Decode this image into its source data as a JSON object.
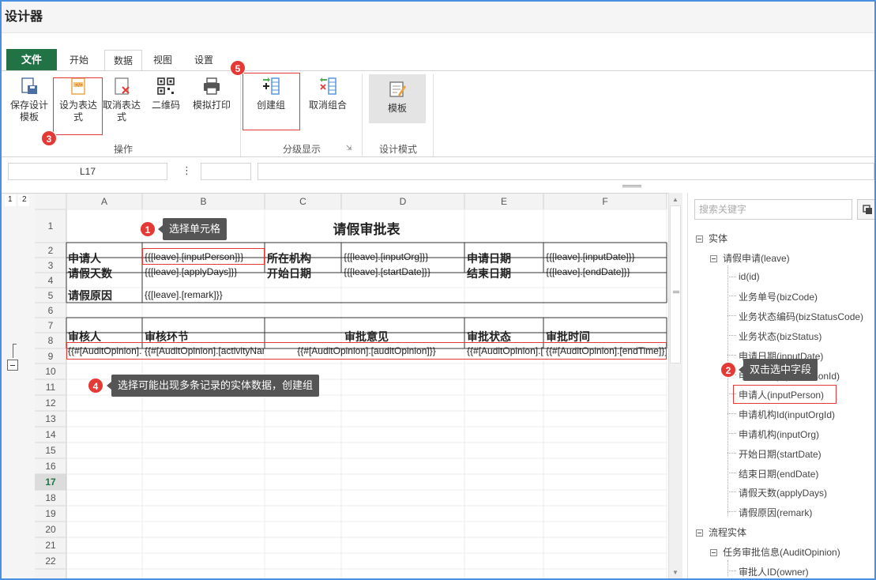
{
  "window": {
    "title": "设计器"
  },
  "tabs": [
    {
      "label": "文件"
    },
    {
      "label": "开始"
    },
    {
      "label": "数据"
    },
    {
      "label": "视图"
    },
    {
      "label": "设置"
    }
  ],
  "ribbon": {
    "save_template": "保存设计模板",
    "set_expression": "设为表达式",
    "cancel_expression": "取消表达式",
    "qrcode": "二维码",
    "simulate_print": "模拟打印",
    "create_group": "创建组",
    "ungroup": "取消组合",
    "template": "模板",
    "group_operate": "操作",
    "group_outline": "分级显示",
    "group_design": "设计模式"
  },
  "formula_bar": {
    "cell_ref": "L17",
    "sep": "⋮"
  },
  "sheet": {
    "outline_levels": [
      "1",
      "2"
    ],
    "col_headers": [
      "A",
      "B",
      "C",
      "D",
      "E",
      "F"
    ],
    "row_headers": [
      "1",
      "2",
      "3",
      "4",
      "5",
      "6",
      "7",
      "8",
      "9",
      "10",
      "11",
      "12",
      "13",
      "14",
      "15",
      "16",
      "17",
      "18",
      "19",
      "20",
      "21",
      "22"
    ],
    "title": "请假审批表",
    "r2": [
      "申请人",
      "{{[leave].[inputPerson]}}",
      "所在机构",
      "{{[leave].[inputOrg]}}",
      "申请日期",
      "{{[leave].[inputDate]}}"
    ],
    "r3": [
      "请假天数",
      "{{[leave].[applyDays]}}",
      "开始日期",
      "{{[leave].[startDate]}}",
      "结束日期",
      "{{[leave].[endDate]}}"
    ],
    "r4": [
      "请假原因",
      "{{[leave].[remark]}}"
    ],
    "r7": [
      "审核人",
      "审核环节",
      "审批意见",
      "审批状态",
      "审批时间"
    ],
    "r8": [
      "{{#[AuditOpinion].[owner]}}",
      "{{#[AuditOpinion].[activityName]}}",
      "{{#[AuditOpinion].[auditOpinion]}}",
      "{{#[AuditOpinion].[status]}}",
      "{{#[AuditOpinion].[endTime]}}"
    ]
  },
  "callouts": {
    "c1": {
      "num": "1",
      "text": "选择单元格"
    },
    "c2": {
      "num": "2",
      "text": "双击选中字段"
    },
    "c3": {
      "num": "3"
    },
    "c4": {
      "num": "4",
      "text": "选择可能出现多条记录的实体数据，创建组"
    },
    "c5": {
      "num": "5"
    }
  },
  "panel": {
    "search_placeholder": "搜索关键字",
    "tree": [
      {
        "label": "实体",
        "level": 0,
        "expandable": true
      },
      {
        "label": "请假申请(leave)",
        "level": 1,
        "expandable": true
      },
      {
        "label": "id(id)",
        "level": 2
      },
      {
        "label": "业务单号(bizCode)",
        "level": 2
      },
      {
        "label": "业务状态编码(bizStatusCode)",
        "level": 2
      },
      {
        "label": "业务状态(bizStatus)",
        "level": 2
      },
      {
        "label": "申请日期(inputDate)",
        "level": 2
      },
      {
        "label": "申请人Id(inputPersonId)",
        "level": 2
      },
      {
        "label": "申请人(inputPerson)",
        "level": 2
      },
      {
        "label": "申请机构Id(inputOrgId)",
        "level": 2
      },
      {
        "label": "申请机构(inputOrg)",
        "level": 2
      },
      {
        "label": "开始日期(startDate)",
        "level": 2
      },
      {
        "label": "结束日期(endDate)",
        "level": 2
      },
      {
        "label": "请假天数(applyDays)",
        "level": 2
      },
      {
        "label": "请假原因(remark)",
        "level": 2
      },
      {
        "label": "流程实体",
        "level": 0,
        "expandable": true
      },
      {
        "label": "任务审批信息(AuditOpinion)",
        "level": 1,
        "expandable": true
      },
      {
        "label": "审批人ID(owner)",
        "level": 2
      }
    ]
  },
  "colors": {
    "accent": "#217346",
    "highlight": "#e53935",
    "frame": "#4a90e2"
  }
}
